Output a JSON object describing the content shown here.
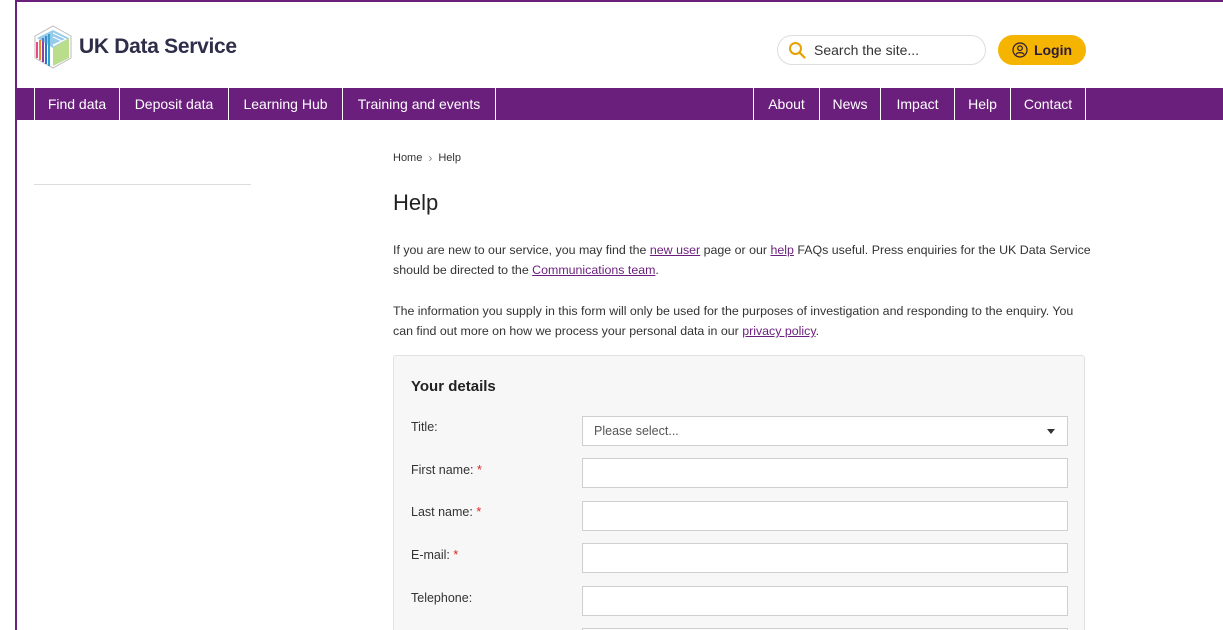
{
  "brand": {
    "name": "UK Data Service"
  },
  "search": {
    "placeholder": "Search the site..."
  },
  "login": {
    "label": "Login"
  },
  "nav": {
    "left": [
      "Find data",
      "Deposit data",
      "Learning Hub",
      "Training and events"
    ],
    "right": [
      "About",
      "News",
      "Impact",
      "Help",
      "Contact"
    ]
  },
  "breadcrumb": {
    "home": "Home",
    "current": "Help"
  },
  "page": {
    "title": "Help",
    "p1_a": "If you are new to our service, you may find the ",
    "p1_link1": "new user",
    "p1_b": " page or our ",
    "p1_link2": "help",
    "p1_c": " FAQs useful. Press enquiries for the UK Data Service should be directed to the ",
    "p1_link3": "Communications team",
    "p1_d": ".",
    "p2_a": "The information you supply in this form will only be used for the purposes of investigation and responding to the enquiry. You can find out more on how we process your personal data in our ",
    "p2_link": "privacy policy",
    "p2_b": "."
  },
  "form": {
    "heading": "Your details",
    "title_label": "Title:",
    "title_value": "Please select...",
    "first_name_label": "First name:",
    "last_name_label": "Last name:",
    "email_label": "E-mail:",
    "telephone_label": "Telephone:",
    "required_mark": "*"
  },
  "colors": {
    "brand_purple": "#6b1f7c",
    "login_yellow": "#f4b400"
  }
}
